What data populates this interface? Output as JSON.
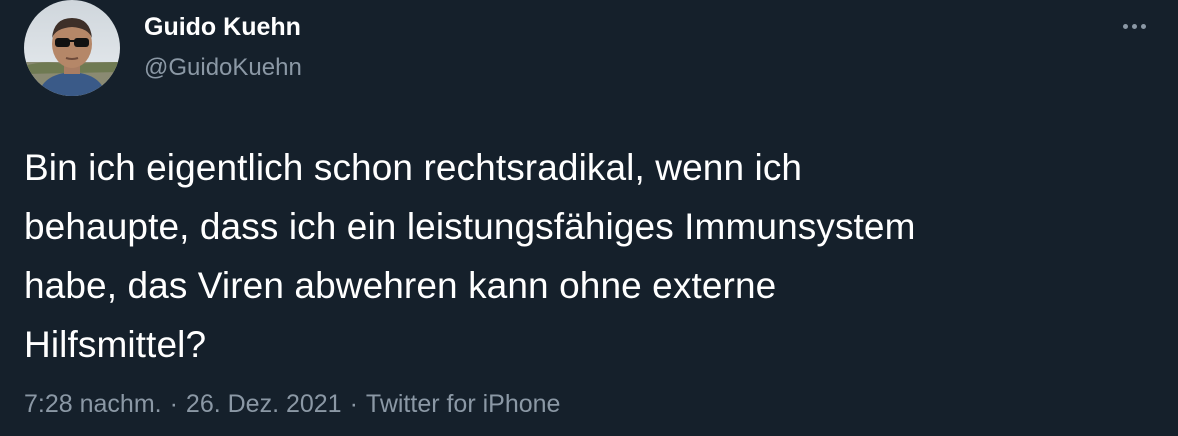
{
  "tweet": {
    "author": {
      "display_name": "Guido Kuehn",
      "handle": "@GuidoKuehn",
      "avatar_icon": "profile-photo"
    },
    "more_icon": "more-horizontal-icon",
    "text": "Bin ich eigentlich schon rechtsradikal, wenn ich\nbehaupte, dass ich ein leistungsfähiges Immunsystem\nhabe, das Viren abwehren kann ohne externe\nHilfsmittel?",
    "meta": {
      "time": "7:28 nachm.",
      "separator": "·",
      "date": "26. Dez. 2021",
      "source": "Twitter for iPhone"
    }
  },
  "colors": {
    "background": "#15202b",
    "primary_text": "#ffffff",
    "secondary_text": "#8b98a5"
  }
}
